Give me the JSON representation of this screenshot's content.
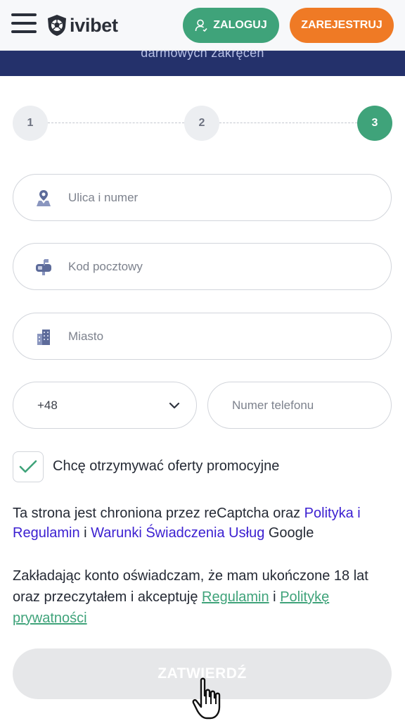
{
  "header": {
    "brand": "ivibet",
    "login_label": "ZALOGUJ",
    "register_label": "ZAREJESTRUJ",
    "menu_icon": "hamburger-icon",
    "login_icon": "user-icon",
    "logo_icon": "soccer-ball-shield-icon"
  },
  "banner": {
    "text": "darmowych zakręceń"
  },
  "steps": {
    "items": [
      "1",
      "2",
      "3"
    ],
    "active": 3
  },
  "form": {
    "street": {
      "placeholder": "Ulica i numer",
      "icon": "map-pin-icon"
    },
    "postal": {
      "placeholder": "Kod pocztowy",
      "icon": "mailbox-icon"
    },
    "city": {
      "placeholder": "Miasto",
      "icon": "buildings-icon"
    },
    "country_code": {
      "value": "+48",
      "icon": "chevron-down-icon"
    },
    "phone": {
      "placeholder": "Numer telefonu"
    },
    "promo_checkbox": {
      "checked": true,
      "label": "Chcę otrzymywać oferty promocyjne"
    }
  },
  "recaptcha": {
    "text_before": "Ta strona jest chroniona przez reCaptcha oraz ",
    "link_policy": "Polityka i Regulamin",
    "text_mid": " i ",
    "link_terms": "Warunki Świadczenia Usług",
    "text_after": " Google"
  },
  "consent": {
    "text_before": "Zakładając konto oświadczam, że mam ukończone 18 lat oraz przeczytałem i akceptuję ",
    "link_rules": "Regulamin",
    "text_mid": " i ",
    "link_privacy": "Politykę prywatności"
  },
  "submit": {
    "label": "ZATWIERDŹ"
  },
  "colors": {
    "green": "#3fa37a",
    "orange": "#ef7a25",
    "navy": "#24316b",
    "link_blue": "#3b1fd1",
    "disabled": "#e6e7e9"
  }
}
